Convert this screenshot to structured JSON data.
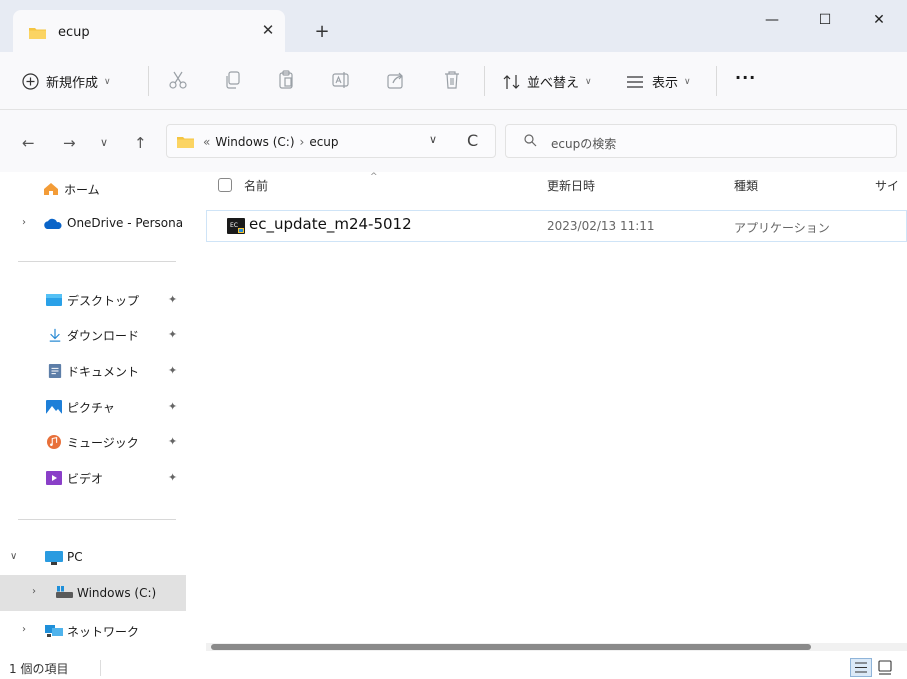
{
  "window": {
    "tab_title": "ecup",
    "tab_close": "✕",
    "new_tab": "+",
    "minimize": "—",
    "maximize": "☐",
    "close": "✕"
  },
  "toolbar": {
    "new_label": "新規作成",
    "sort_label": "並べ替え",
    "view_label": "表示",
    "more": "···",
    "icons": [
      "add-icon",
      "cut-icon",
      "copy-icon",
      "paste-icon",
      "rename-icon",
      "share-icon",
      "delete-icon",
      "sort-icon",
      "view-icon"
    ]
  },
  "nav": {
    "back": "←",
    "forward": "→",
    "recent": "∨",
    "up": "↑",
    "breadcrumb_overflow": "«",
    "breadcrumb": [
      "Windows (C:)",
      "ecup"
    ],
    "dropdown": "∨",
    "refresh": "C",
    "search_placeholder": "ecupの検索"
  },
  "sidebar": {
    "items": [
      {
        "label": "ホーム",
        "icon": "home-icon"
      },
      {
        "label": "OneDrive - Persona",
        "icon": "onedrive-icon"
      },
      {
        "label": "デスクトップ",
        "icon": "desktop-icon"
      },
      {
        "label": "ダウンロード",
        "icon": "download-icon"
      },
      {
        "label": "ドキュメント",
        "icon": "documents-icon"
      },
      {
        "label": "ピクチャ",
        "icon": "pictures-icon"
      },
      {
        "label": "ミュージック",
        "icon": "music-icon"
      },
      {
        "label": "ビデオ",
        "icon": "videos-icon"
      },
      {
        "label": "PC",
        "icon": "pc-icon"
      },
      {
        "label": "Windows (C:)",
        "icon": "drive-icon"
      },
      {
        "label": "ネットワーク",
        "icon": "network-icon"
      }
    ],
    "pin": "📌"
  },
  "columns": {
    "name": "名前",
    "date": "更新日時",
    "type": "種類",
    "size": "サイ"
  },
  "files": [
    {
      "name": "ec_update_m24-5012",
      "date": "2023/02/13 11:11",
      "type": "アプリケーション",
      "icon": "exe-icon"
    }
  ],
  "status": {
    "count": "1 個の項目"
  },
  "colors": {
    "accent": "#0067c0",
    "folder": "#f4c542",
    "selection_border": "#cfe4f7",
    "scroll_thumb": "#8a8a8a"
  }
}
